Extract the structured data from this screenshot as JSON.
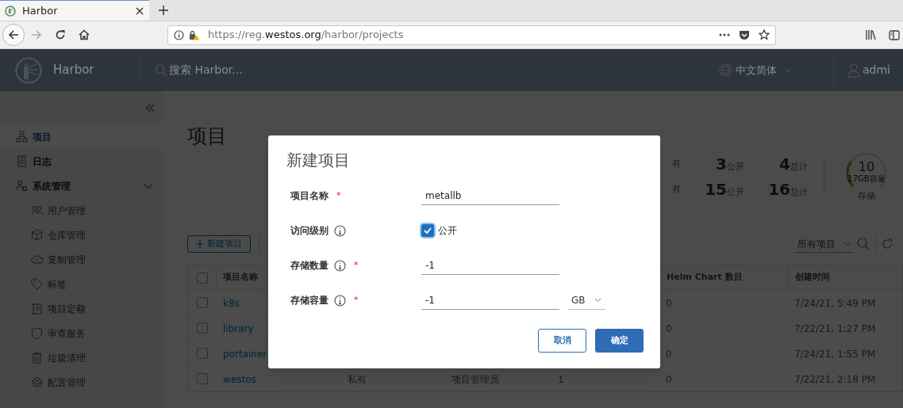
{
  "browser": {
    "tab": {
      "title": "Harbor",
      "selected": true
    },
    "url": {
      "prefix": "https://reg.",
      "domain": "westos.org",
      "path": "/harbor/projects"
    }
  },
  "header": {
    "brand": "Harbor",
    "search": {
      "placeholder": "搜索 Harbor..."
    },
    "language": "中文简体",
    "user": "admi"
  },
  "sidebar": {
    "items": [
      {
        "label": "项目",
        "selected": true
      },
      {
        "label": "日志",
        "selected": false
      },
      {
        "label": "系统管理",
        "selected": false,
        "expanded": true,
        "children": [
          {
            "label": "用户管理",
            "selected": false
          },
          {
            "label": "仓库管理",
            "selected": false
          },
          {
            "label": "复制管理",
            "selected": false
          },
          {
            "label": "标签",
            "selected": false
          },
          {
            "label": "项目定额",
            "selected": false
          },
          {
            "label": "审查服务",
            "selected": false
          },
          {
            "label": "垃圾清理",
            "selected": false
          },
          {
            "label": "配置管理",
            "selected": false
          }
        ]
      }
    ]
  },
  "page": {
    "title": "项目",
    "stats": [
      {
        "private_label": "有",
        "public": "3",
        "public_label": "公开",
        "total": "4",
        "total_label": "总计"
      },
      {
        "private_label": "有",
        "public": "15",
        "public_label": "公开",
        "total": "16",
        "total_label": "总计"
      }
    ],
    "storage": {
      "value": "10",
      "caption": "17GB容量",
      "label": "存储",
      "level": 0.3
    },
    "toolbar": {
      "new_button": "新建项目",
      "filter": "所有项目"
    },
    "table": {
      "select_all": {
        "checked": false
      },
      "columns": {
        "name": "项目名称",
        "helm_charts": "Helm Chart 数目",
        "created": "创建时间"
      },
      "rows": [
        {
          "selected": false,
          "name": "k8s",
          "helm_charts": "0",
          "created": "7/24/21, 5:49 PM"
        },
        {
          "selected": false,
          "name": "library",
          "helm_charts": "0",
          "created": "7/22/21, 1:27 PM"
        },
        {
          "selected": false,
          "name": "portainer",
          "helm_charts": "0",
          "created": "7/24/21, 1:55 PM"
        },
        {
          "selected": false,
          "name": "westos",
          "access": "私有",
          "role": "项目管理员",
          "repositories": "1",
          "helm_charts": "0",
          "created": "7/22/21, 2:18 PM"
        }
      ]
    }
  },
  "dialog": {
    "title": "新建项目",
    "fields": [
      {
        "kind": "text",
        "label": "项目名称",
        "info": false,
        "required_mark": "*",
        "value": "metallb"
      },
      {
        "kind": "checkbox",
        "label": "访问级别",
        "info": true,
        "checked": true,
        "option": "公开"
      },
      {
        "kind": "text",
        "label": "存储数量",
        "info": true,
        "required_mark": "*",
        "value": "-1"
      },
      {
        "kind": "text_unit",
        "label": "存储容量",
        "info": true,
        "required_mark": "*",
        "value": "-1",
        "unit": "GB"
      }
    ],
    "buttons": [
      {
        "kind": "secondary",
        "label": "取消"
      },
      {
        "kind": "primary",
        "label": "确定"
      }
    ]
  }
}
